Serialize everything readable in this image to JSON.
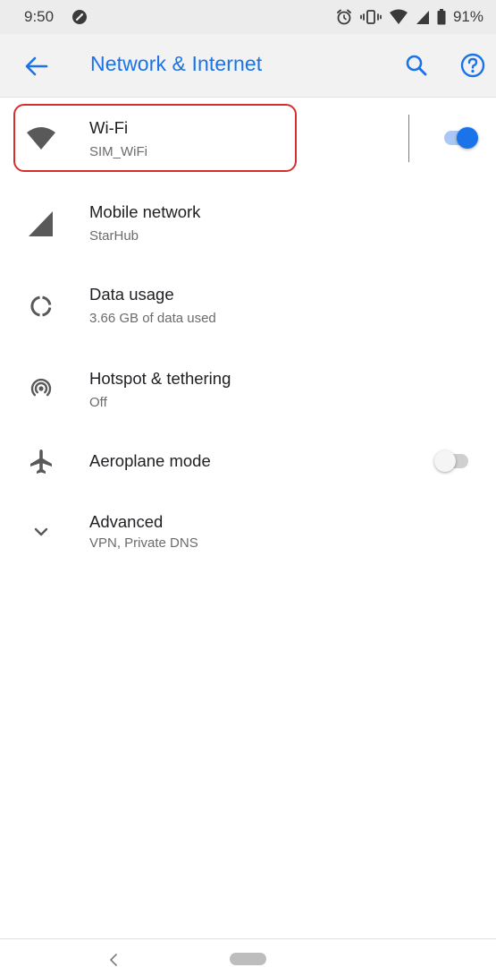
{
  "status_bar": {
    "time": "9:50",
    "battery_percent": "91%"
  },
  "app_bar": {
    "title": "Network & Internet",
    "accent_color": "#1a73e8"
  },
  "settings": {
    "wifi": {
      "title": "Wi-Fi",
      "subtitle": "SIM_WiFi",
      "toggle_on": true
    },
    "mobile_network": {
      "title": "Mobile network",
      "subtitle": "StarHub"
    },
    "data_usage": {
      "title": "Data usage",
      "subtitle": "3.66 GB of data used"
    },
    "hotspot": {
      "title": "Hotspot & tethering",
      "subtitle": "Off"
    },
    "aeroplane": {
      "title": "Aeroplane mode",
      "toggle_on": false
    },
    "advanced": {
      "title": "Advanced",
      "subtitle": "VPN, Private DNS"
    }
  },
  "icons": {
    "status": [
      "data-saver-icon",
      "alarm-icon",
      "vibrate-icon",
      "wifi-signal-icon",
      "cell-signal-icon",
      "battery-icon"
    ],
    "app_bar": [
      "back-arrow-icon",
      "search-icon",
      "help-icon"
    ],
    "rows": [
      "wifi-icon",
      "cell-signal-icon",
      "data-usage-icon",
      "hotspot-icon",
      "airplane-icon",
      "chevron-down-icon"
    ]
  }
}
